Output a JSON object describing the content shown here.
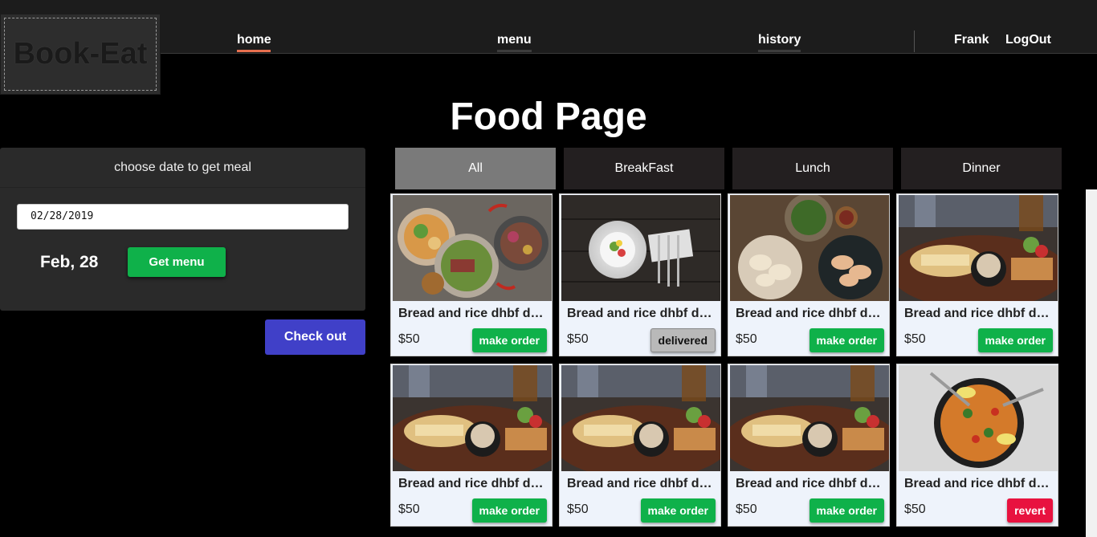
{
  "logo": "Book-Eat",
  "nav": {
    "home": "home",
    "menu": "menu",
    "history": "history",
    "user": "Frank",
    "logout": "LogOut"
  },
  "page_title": "Food Page",
  "panel": {
    "header": "choose date to get meal",
    "date_value": "02/28/2019",
    "date_label": "Feb, 28",
    "get_menu": "Get menu"
  },
  "checkout": "Check out",
  "tabs": [
    "All",
    "BreakFast",
    "Lunch",
    "Dinner"
  ],
  "active_tab": "All",
  "cards": [
    {
      "title": "Bread and rice dhbf dsfsdfsdf",
      "price": "$50",
      "action": "make order",
      "state": "order",
      "image": "salad-plates-photo"
    },
    {
      "title": "Bread and rice dhbf dsfsdfsdf",
      "price": "$50",
      "action": "delivered",
      "state": "delivered",
      "image": "plate-cutlery-photo"
    },
    {
      "title": "Bread and rice dhbf dsfsdfsdf",
      "price": "$50",
      "action": "make order",
      "state": "order",
      "image": "dumplings-photo"
    },
    {
      "title": "Bread and rice dhbf dsfsdfsdf",
      "price": "$50",
      "action": "make order",
      "state": "order",
      "image": "chicken-plate-photo"
    },
    {
      "title": "Bread and rice dhbf dsfsdfsdf",
      "price": "$50",
      "action": "make order",
      "state": "order",
      "image": "chicken-plate-photo"
    },
    {
      "title": "Bread and rice dhbf dsfsdfsdf",
      "price": "$50",
      "action": "make order",
      "state": "order",
      "image": "chicken-plate-photo"
    },
    {
      "title": "Bread and rice dhbf dsfsdfsdf",
      "price": "$50",
      "action": "make order",
      "state": "order",
      "image": "chicken-plate-photo"
    },
    {
      "title": "Bread and rice dhbf dsfsdfsdf",
      "price": "$50",
      "action": "revert",
      "state": "revert",
      "image": "paella-pan-photo"
    }
  ],
  "colors": {
    "accent_green": "#0fb14a",
    "checkout_blue": "#4040c8",
    "revert_red": "#e8123f",
    "nav_active": "#e8704f"
  }
}
